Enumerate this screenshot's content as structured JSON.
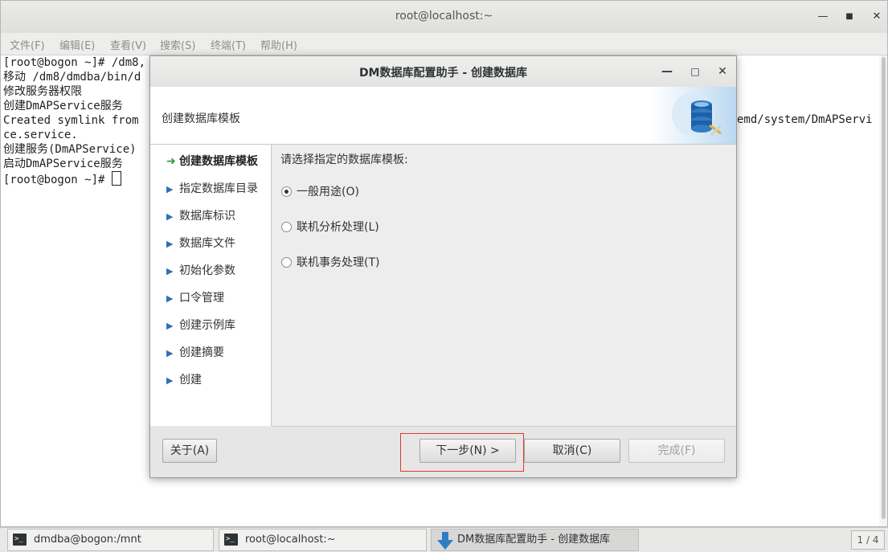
{
  "terminal": {
    "title": "root@localhost:~",
    "menu": [
      "文件(F)",
      "编辑(E)",
      "查看(V)",
      "搜索(S)",
      "终端(T)",
      "帮助(H)"
    ],
    "lines": [
      "[root@bogon ~]# /dm8,",
      "移动 /dm8/dmdba/bin/d",
      "修改服务器权限",
      "创建DmAPService服务",
      "Created symlink from",
      "ce.service.",
      "创建服务(DmAPService)",
      "启动DmAPService服务",
      "[root@bogon ~]# "
    ],
    "right_fragment": "emd/system/DmAPServi"
  },
  "dialog": {
    "title": "DM数据库配置助手 - 创建数据库",
    "header_title": "创建数据库模板",
    "steps": [
      {
        "label": "创建数据库模板",
        "current": true
      },
      {
        "label": "指定数据库目录",
        "current": false
      },
      {
        "label": "数据库标识",
        "current": false
      },
      {
        "label": "数据库文件",
        "current": false
      },
      {
        "label": "初始化参数",
        "current": false
      },
      {
        "label": "口令管理",
        "current": false
      },
      {
        "label": "创建示例库",
        "current": false
      },
      {
        "label": "创建摘要",
        "current": false
      },
      {
        "label": "创建",
        "current": false
      }
    ],
    "prompt": "请选择指定的数据库模板:",
    "options": [
      {
        "label": "一般用途(O)",
        "selected": true
      },
      {
        "label": "联机分析处理(L)",
        "selected": false
      },
      {
        "label": "联机事务处理(T)",
        "selected": false
      }
    ],
    "buttons": {
      "about": "关于(A)",
      "next": "下一步(N) >",
      "cancel": "取消(C)",
      "finish": "完成(F)"
    }
  },
  "taskbar": {
    "tasks": [
      "dmdba@bogon:/mnt",
      "root@localhost:~",
      "DM数据库配置助手 - 创建数据库"
    ],
    "pager": "1 / 4"
  },
  "colors": {
    "current_step_arrow": "#2a9d3a",
    "step_triangle": "#2f6fb3",
    "focus_highlight": "#e0392b"
  }
}
